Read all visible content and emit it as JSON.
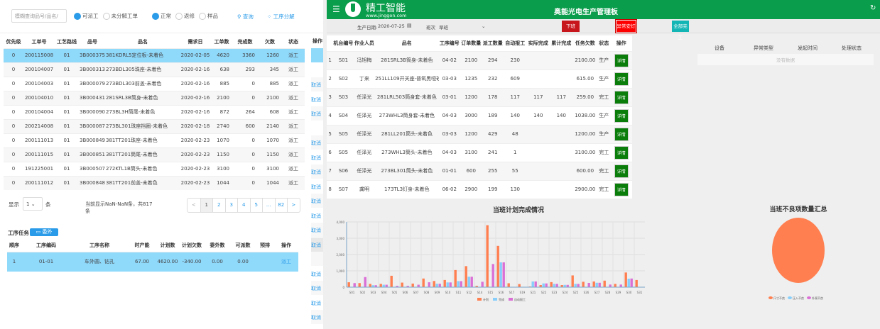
{
  "left": {
    "search_placeholder": "模糊查询品号/品名/",
    "filters": [
      {
        "label": "可派工",
        "checked": true
      },
      {
        "label": "未分解工单",
        "checked": false
      },
      {
        "label": "正常",
        "checked": true
      },
      {
        "label": "返修",
        "checked": false
      },
      {
        "label": "样品",
        "checked": false
      }
    ],
    "query_label": "查询",
    "split_label": "工序分解",
    "columns": [
      "优先级",
      "工单号",
      "工艺路线",
      "品号",
      "品名",
      "需求日",
      "工单数",
      "完成数",
      "欠数",
      "状态",
      "操作"
    ],
    "rows": [
      [
        "0",
        "200115008",
        "01",
        "3B000375",
        "381KDRL5定位板-未着色",
        "2020-02-05",
        "4620",
        "3360",
        "1260",
        "派工"
      ],
      [
        "0",
        "200104007",
        "01",
        "3B000313",
        "273BDL305珠座-未着色",
        "2020-02-16",
        "638",
        "293",
        "345",
        "派工"
      ],
      [
        "0",
        "200104003",
        "01",
        "3B000079",
        "273BDL303前盖-未着色",
        "2020-02-16",
        "885",
        "0",
        "885",
        "派工"
      ],
      [
        "0",
        "200104010",
        "01",
        "3B000431",
        "281SRL3B筒身-未着色",
        "2020-02-16",
        "2100",
        "0",
        "2100",
        "派工"
      ],
      [
        "0",
        "200104004",
        "01",
        "3B000090",
        "273BL3H筒尾-未着色",
        "2020-02-16",
        "872",
        "264",
        "608",
        "派工"
      ],
      [
        "0",
        "200214008",
        "01",
        "3B000087",
        "273BL301珠座挡圈-未着色",
        "2020-02-18",
        "2740",
        "600",
        "2140",
        "派工"
      ],
      [
        "0",
        "200111013",
        "01",
        "3B000849",
        "381TT201珠座-未着色",
        "2020-02-23",
        "1070",
        "0",
        "1070",
        "派工"
      ],
      [
        "0",
        "200111015",
        "01",
        "3B000851",
        "381TT201筒尾-未着色",
        "2020-02-23",
        "1150",
        "0",
        "1150",
        "派工"
      ],
      [
        "0",
        "191225001",
        "01",
        "3B000507",
        "272KTL1B筒头-未着色",
        "2020-02-23",
        "3100",
        "0",
        "3100",
        "派工"
      ],
      [
        "0",
        "200111012",
        "01",
        "3B000848",
        "381TT201前盖-未着色",
        "2020-02-23",
        "1044",
        "0",
        "1044",
        "派工"
      ]
    ],
    "cancel_label": "取消",
    "show_label": "显示",
    "page_size": "1",
    "unit_label": "条",
    "page_info": "当前显示NaN-NaN条，共817条",
    "pages": [
      "<",
      "1",
      "2",
      "3",
      "4",
      "5",
      "...",
      "82",
      ">"
    ],
    "task_title": "工序任务",
    "outsource_label": "委外",
    "task_columns": [
      "顺序",
      "工序编码",
      "工序名称",
      "时产能",
      "计划数",
      "计划欠数",
      "委外数",
      "可派数",
      "预排",
      "操作"
    ],
    "task_rows": [
      [
        "1",
        "01-01",
        "车外圆、钻孔",
        "67.00",
        "4620.00",
        "-340.00",
        "0.00",
        "0.00",
        "",
        "派工"
      ]
    ]
  },
  "right": {
    "logo_cn": "精工智能",
    "logo_url": "www.jinggon.com",
    "title": "奥能光电生产管理板",
    "date_label": "生产日期:",
    "date_value": "2020-07-25",
    "shift_label": "班次",
    "shift_value": "早班",
    "buttons": {
      "off": "下班",
      "alarm": "异常安灯",
      "finish": "全部完工"
    },
    "colors": {
      "header": "#0a9d4b",
      "off": "#c8161d",
      "alarm": "#ff0000",
      "finish": "#14b5b5",
      "detail": "#0a7d0a"
    },
    "columns": [
      "机台编号",
      "作业人员",
      "品名",
      "工序编号",
      "订单数量",
      "派工数量",
      "自动报工",
      "实际完成",
      "累计完成",
      "任务欠数",
      "状态",
      "操作"
    ],
    "rows": [
      [
        "1",
        "S01",
        "冯旭梅",
        "281SRL3B筒身-未着色",
        "04-02",
        "2100",
        "294",
        "230",
        "",
        "",
        "2100.00",
        "生产"
      ],
      [
        "2",
        "S02",
        "丁来",
        "251LL109开关座-普氧黑哑砂",
        "03-03",
        "1235",
        "232",
        "609",
        "",
        "",
        "615.00",
        "生产"
      ],
      [
        "3",
        "S03",
        "任泽光",
        "281LRL503筒身套-未着色",
        "03-01",
        "1200",
        "178",
        "117",
        "117",
        "117",
        "259.00",
        "完工"
      ],
      [
        "4",
        "S04",
        "任泽光",
        "273WHL3筒身套-未着色",
        "04-03",
        "3000",
        "189",
        "140",
        "140",
        "140",
        "1038.00",
        "生产"
      ],
      [
        "5",
        "S05",
        "任泽光",
        "281LL201筒头-未着色",
        "03-03",
        "1200",
        "429",
        "48",
        "",
        "",
        "1200.00",
        "生产"
      ],
      [
        "6",
        "S05",
        "任泽光",
        "273WHL3筒头-未着色",
        "04-03",
        "3100",
        "241",
        "1",
        "",
        "",
        "3100.00",
        "完工"
      ],
      [
        "7",
        "S06",
        "任泽光",
        "273BL301筒头-未着色",
        "01-01",
        "600",
        "255",
        "55",
        "",
        "",
        "600.00",
        "完工"
      ],
      [
        "8",
        "S07",
        "龚明",
        "173TL3灯身-未着色",
        "06-02",
        "2900",
        "199",
        "130",
        "",
        "",
        "2900.00",
        "完工"
      ]
    ],
    "detail_label": "详情",
    "alarm_columns": [
      "设备",
      "异常类型",
      "发起时间",
      "处理状态"
    ],
    "alarm_empty": "没有数据"
  },
  "chart_data": [
    {
      "type": "bar",
      "title": "当班计划完成情况",
      "ylim": [
        0,
        4000
      ],
      "yticks": [
        "0",
        "1,000",
        "2,000",
        "3,000",
        "4,000"
      ],
      "grid": true,
      "legend": "bottom",
      "categories": [
        "S01",
        "S02",
        "S03",
        "S04",
        "S05",
        "S06",
        "S07",
        "S08",
        "S09",
        "S10",
        "S11",
        "S12",
        "S14",
        "S15",
        "S16",
        "S17",
        "S19",
        "S21",
        "S22",
        "S23",
        "S24",
        "S25",
        "S26",
        "S27",
        "S28",
        "S29",
        "S30",
        "S31"
      ],
      "series": [
        {
          "name": "计划",
          "color": "#ff7f50",
          "values": [
            300,
            250,
            200,
            200,
            700,
            280,
            220,
            530,
            380,
            440,
            1050,
            1290,
            80,
            3800,
            2530,
            240,
            190,
            40,
            130,
            310,
            130,
            720,
            330,
            350,
            400,
            200,
            900,
            440
          ]
        },
        {
          "name": "完成",
          "color": "#87cefa",
          "values": [
            0,
            0,
            120,
            150,
            0,
            0,
            0,
            0,
            210,
            290,
            370,
            640,
            0,
            0,
            1520,
            0,
            0,
            350,
            230,
            200,
            140,
            200,
            0,
            270,
            0,
            0,
            520,
            0
          ]
        },
        {
          "name": "自动报工",
          "color": "#da70d6",
          "values": [
            250,
            620,
            120,
            150,
            80,
            80,
            150,
            300,
            210,
            290,
            370,
            640,
            330,
            1420,
            1520,
            0,
            0,
            350,
            230,
            200,
            140,
            200,
            260,
            270,
            160,
            160,
            530,
            0
          ]
        }
      ]
    },
    {
      "type": "pie",
      "title": "当班不良项数量汇总",
      "legend": "bottom",
      "labels": [
        "尺寸不良",
        "压入不良",
        "外观不良"
      ],
      "colors": [
        "#ff7f50",
        "#87cefa",
        "#da70d6"
      ],
      "values": [
        1,
        0,
        0
      ]
    }
  ]
}
